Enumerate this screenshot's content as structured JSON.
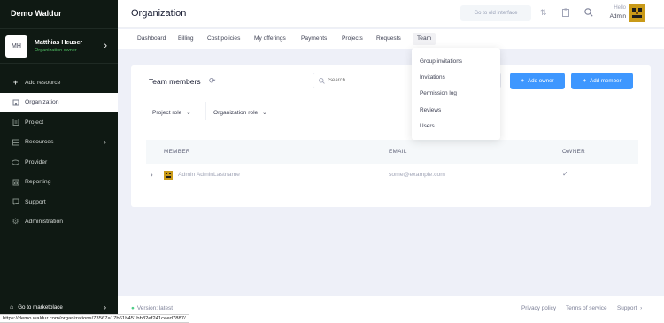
{
  "sidebar": {
    "brand": "Demo Waldur",
    "profile": {
      "initials": "MH",
      "name": "Matthias Heuser",
      "role": "Organization owner"
    },
    "items": [
      {
        "label": "Add resource",
        "icon": "plus-icon"
      },
      {
        "label": "Organization",
        "icon": "building-icon"
      },
      {
        "label": "Project",
        "icon": "project-icon"
      },
      {
        "label": "Resources",
        "icon": "layers-icon"
      },
      {
        "label": "Provider",
        "icon": "cloud-icon"
      },
      {
        "label": "Reporting",
        "icon": "chart-icon"
      },
      {
        "label": "Support",
        "icon": "help-icon"
      },
      {
        "label": "Administration",
        "icon": "gear-icon"
      }
    ],
    "marketplace": "Go to marketplace"
  },
  "header": {
    "title": "Organization",
    "old_interface": "Go to old interface",
    "hello": "Hello",
    "user": "Admin"
  },
  "tabs": [
    "Dashboard",
    "Billing",
    "Cost policies",
    "My offerings",
    "Payments",
    "Projects",
    "Requests",
    "Team"
  ],
  "team_menu": [
    "Group invitations",
    "Invitations",
    "Permission log",
    "Reviews",
    "Users"
  ],
  "card": {
    "title": "Team members",
    "search_placeholder": "Search ...",
    "add_owner": "Add owner",
    "add_member": "Add member",
    "filters": [
      "Project role",
      "Organization role"
    ],
    "columns": [
      "MEMBER",
      "EMAIL",
      "OWNER"
    ],
    "rows": [
      {
        "member": "Admin AdminLastname",
        "email": "some@example.com",
        "owner": true
      }
    ]
  },
  "footer": {
    "version": "Version: latest",
    "links": [
      "Privacy policy",
      "Terms of service",
      "Support"
    ]
  },
  "status_url": "https://demo.waldur.com/organizations/73567a17b61b451bb82ef241ceed7887/",
  "colors": {
    "sidebar_bg": "#0f1913",
    "primary": "#3e97ff",
    "role_green": "#4fbf63"
  }
}
